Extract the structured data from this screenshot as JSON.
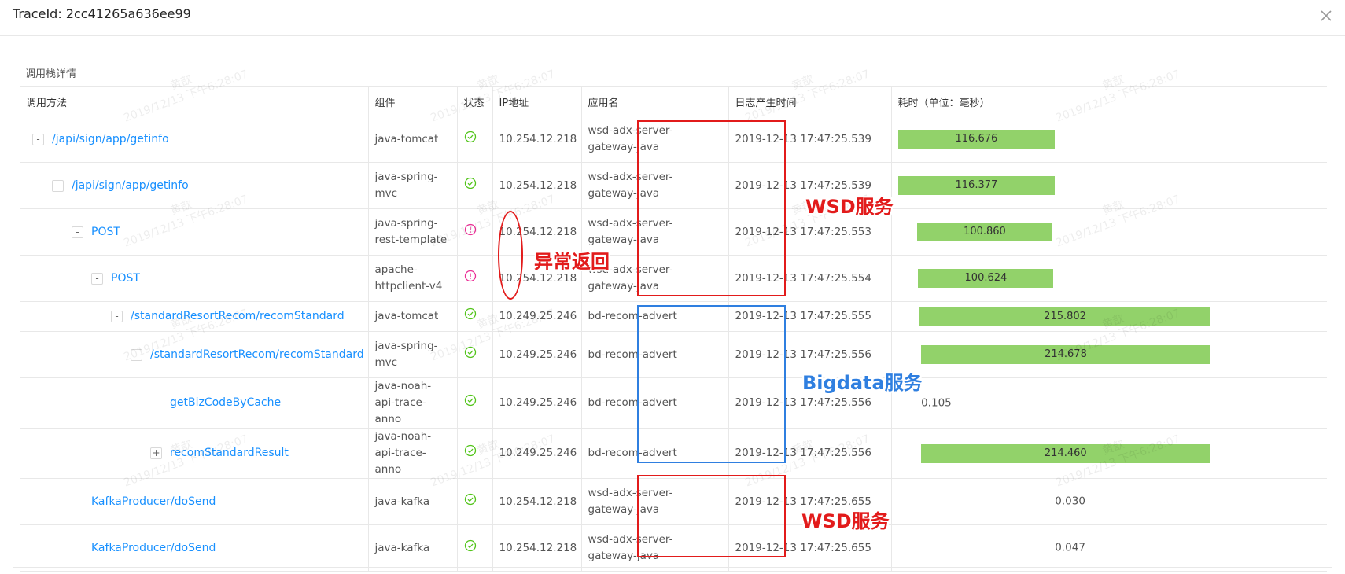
{
  "header": {
    "title": "TraceId: 2cc41265a636ee99",
    "close_icon": "close-icon"
  },
  "card": {
    "title": "调用栈详情"
  },
  "columns": {
    "method": "调用方法",
    "component": "组件",
    "status": "状态",
    "ip": "IP地址",
    "app": "应用名",
    "log_time": "日志产生时间",
    "duration": "耗时（单位：毫秒）"
  },
  "rows": [
    {
      "toggle": "-",
      "method": "/japi/sign/app/getinfo",
      "component": "java-tomcat",
      "status": "ok",
      "ip": "10.254.12.218",
      "app": "wsd-adx-server-gateway-java",
      "time": "2019-12-13 17:47:25.539",
      "duration": "116.676",
      "bar_start": 0.0,
      "bar_fill": 0.54
    },
    {
      "toggle": "-",
      "method": "/japi/sign/app/getinfo",
      "component": "java-spring-mvc",
      "status": "ok",
      "ip": "10.254.12.218",
      "app": "wsd-adx-server-gateway-java",
      "time": "2019-12-13 17:47:25.539",
      "duration": "116.377",
      "bar_start": 0.0,
      "bar_fill": 0.54
    },
    {
      "toggle": "-",
      "method": "POST",
      "component": "java-spring-rest-template",
      "status": "error",
      "ip": "10.254.12.218",
      "app": "wsd-adx-server-gateway-java",
      "time": "2019-12-13 17:47:25.553",
      "duration": "100.860",
      "bar_start": 0.065,
      "bar_fill": 0.467
    },
    {
      "toggle": "-",
      "method": "POST",
      "component": "apache-httpclient-v4",
      "status": "error",
      "ip": "10.254.12.218",
      "app": "wsd-adx-server-gateway-java",
      "time": "2019-12-13 17:47:25.554",
      "duration": "100.624",
      "bar_start": 0.07,
      "bar_fill": 0.465
    },
    {
      "toggle": "-",
      "method": "/standardResortRecom/recomStandard",
      "component": "java-tomcat",
      "status": "ok",
      "ip": "10.249.25.246",
      "app": "bd-recom-advert",
      "time": "2019-12-13 17:47:25.555",
      "duration": "215.802",
      "bar_start": 0.075,
      "bar_fill": 0.999
    },
    {
      "toggle": "-",
      "method": "/standardResortRecom/recomStandard",
      "component": "java-spring-mvc",
      "status": "ok",
      "ip": "10.249.25.246",
      "app": "bd-recom-advert",
      "time": "2019-12-13 17:47:25.556",
      "duration": "214.678",
      "bar_start": 0.08,
      "bar_fill": 0.994
    },
    {
      "toggle": "",
      "method": "getBizCodeByCache",
      "component": "java-noah-api-trace-anno",
      "status": "ok",
      "ip": "10.249.25.246",
      "app": "bd-recom-advert",
      "time": "2019-12-13 17:47:25.556",
      "duration": "0.105",
      "bar_start": 0.08,
      "bar_fill": 0.0
    },
    {
      "toggle": "+",
      "method": "recomStandardResult",
      "component": "java-noah-api-trace-anno",
      "status": "ok",
      "ip": "10.249.25.246",
      "app": "bd-recom-advert",
      "time": "2019-12-13 17:47:25.556",
      "duration": "214.460",
      "bar_start": 0.08,
      "bar_fill": 0.993
    },
    {
      "toggle": "",
      "method": "KafkaProducer/doSend",
      "component": "java-kafka",
      "status": "ok",
      "ip": "10.254.12.218",
      "app": "wsd-adx-server-gateway-java",
      "time": "2019-12-13 17:47:25.655",
      "duration": "0.030",
      "bar_start": 0.54,
      "bar_fill": 0.0
    },
    {
      "toggle": "",
      "method": "KafkaProducer/doSend",
      "component": "java-kafka",
      "status": "ok",
      "ip": "10.254.12.218",
      "app": "wsd-adx-server-gateway-java",
      "time": "2019-12-13 17:47:25.655",
      "duration": "0.047",
      "bar_start": 0.54,
      "bar_fill": 0.0
    }
  ],
  "watermark": {
    "name": "黄歆",
    "datetime": "2019/12/13 下午6:28:07"
  },
  "annotations": {
    "wsd_label_top": "WSD服务",
    "error_label": "异常返回",
    "bigdata_label": "Bigdata服务",
    "wsd_label_bottom": "WSD服务"
  },
  "colors": {
    "link": "#1890ff",
    "ok": "#52c41a",
    "error": "#eb2f96",
    "bar": "#92d26a",
    "annot_red": "#e21b1b",
    "annot_blue": "#2f7fe0"
  }
}
